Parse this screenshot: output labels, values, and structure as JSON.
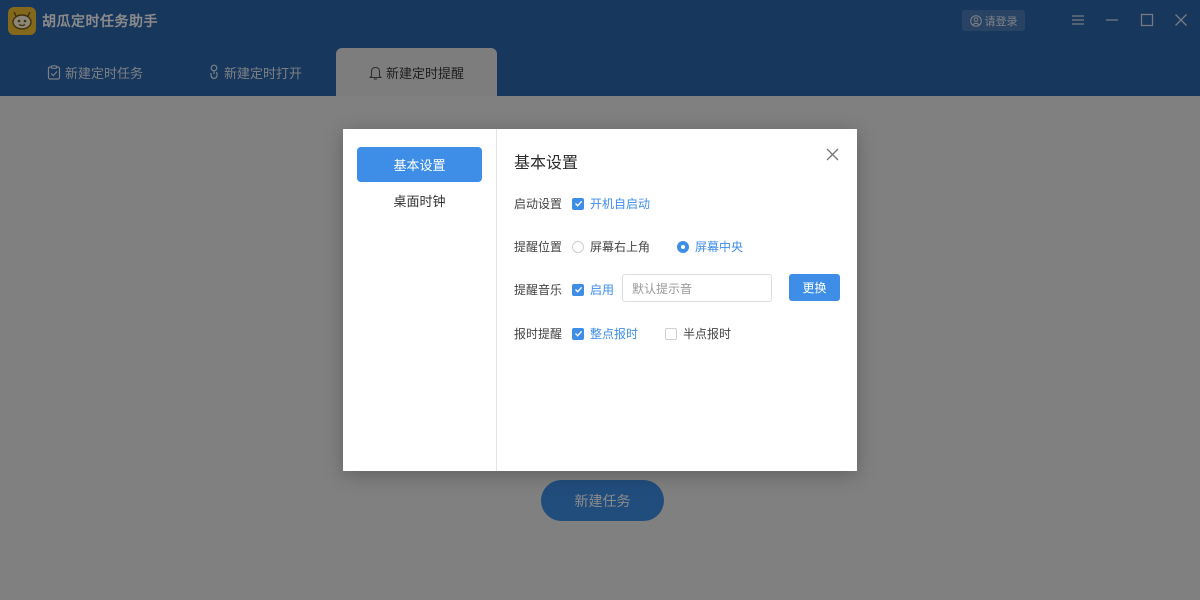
{
  "app": {
    "title": "胡瓜定时任务助手",
    "login_label": "请登录"
  },
  "icons": {
    "logo": "cucumber-logo-icon",
    "user": "user-circle-icon",
    "menu": "menu-icon",
    "minimize": "minimize-icon",
    "maximize": "maximize-icon",
    "close": "close-icon",
    "task_tab": "clipboard-check-icon",
    "open_tab": "power-hand-icon",
    "remind_tab": "bell-icon"
  },
  "tabs": [
    {
      "label": "新建定时任务",
      "active": false
    },
    {
      "label": "新建定时打开",
      "active": false
    },
    {
      "label": "新建定时提醒",
      "active": true
    }
  ],
  "main": {
    "new_task_label": "新建任务"
  },
  "dialog": {
    "title": "基本设置",
    "sidebar": [
      {
        "label": "基本设置",
        "active": true
      },
      {
        "label": "桌面时钟",
        "active": false
      }
    ],
    "startup": {
      "label": "启动设置",
      "option": {
        "label": "开机自启动",
        "checked": true
      }
    },
    "position": {
      "label": "提醒位置",
      "options": [
        {
          "label": "屏幕右上角",
          "checked": false
        },
        {
          "label": "屏幕中央",
          "checked": true
        }
      ]
    },
    "music": {
      "label": "提醒音乐",
      "enable": {
        "label": "启用",
        "checked": true
      },
      "placeholder": "默认提示音",
      "change_label": "更换"
    },
    "chime": {
      "label": "报时提醒",
      "options": [
        {
          "label": "整点报时",
          "checked": true
        },
        {
          "label": "半点报时",
          "checked": false
        }
      ]
    }
  },
  "colors": {
    "primary": "#2e66ad",
    "accent": "#3e8ee8",
    "logo": "#f4c132"
  }
}
